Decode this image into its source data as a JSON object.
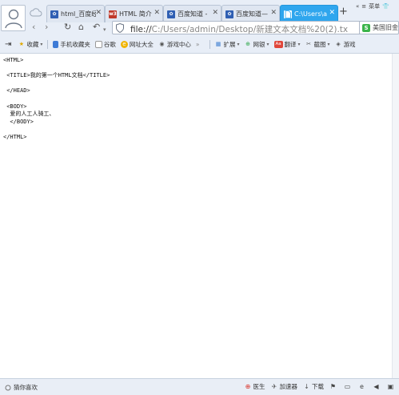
{
  "tabs": [
    {
      "label": "html_百度经",
      "favicon": "baidu-paw-icon",
      "color": "#2f5fb3",
      "active": false
    },
    {
      "label": "HTML 简介",
      "favicon": "w3-icon",
      "color": "#c0392b",
      "active": false
    },
    {
      "label": "百度知道 -",
      "favicon": "baidu-paw-icon",
      "color": "#2f5fb3",
      "active": false
    },
    {
      "label": "百度知道—",
      "favicon": "baidu-paw-icon",
      "color": "#2f5fb3",
      "active": false
    },
    {
      "label": "C:\\Users\\a",
      "favicon": "document-icon",
      "color": "#ffffff",
      "active": true
    }
  ],
  "top_right": {
    "menu_label": "菜单"
  },
  "address": {
    "scheme": "file://",
    "path": "C:/Users/admin/Desktop/新建文本文档%20(2).tx"
  },
  "search": {
    "text": "美国旧金"
  },
  "bookmarks": [
    {
      "label": "收藏",
      "icon": "star-icon",
      "dropdown": true
    },
    {
      "label": "手机收藏夹",
      "icon": "phone-icon",
      "dropdown": false
    },
    {
      "label": "谷歌",
      "icon": "page-icon",
      "dropdown": false
    },
    {
      "label": "网址大全",
      "icon": "globe-icon",
      "dropdown": false
    },
    {
      "label": "游戏中心",
      "icon": "gamepad-icon",
      "dropdown": false
    }
  ],
  "toolbar_right": [
    {
      "label": "扩展",
      "icon": "grid-icon"
    },
    {
      "label": "网银",
      "icon": "bank-icon"
    },
    {
      "label": "翻译",
      "icon": "translate-icon"
    },
    {
      "label": "截图",
      "icon": "scissors-icon"
    },
    {
      "label": "游戏",
      "icon": "game-icon"
    }
  ],
  "document": {
    "text": "<HTML>\n\n <TITLE>我的第一个HTML文档</TITLE>\n\n </HEAD>\n\n <BODY>\n  爱的人工人骑工、\n  </BODY>\n\n</HTML>"
  },
  "status": {
    "left_label": "猜你喜欢",
    "items": [
      {
        "label": "医生",
        "icon": "doctor-icon"
      },
      {
        "label": "加速器",
        "icon": "rocket-icon"
      },
      {
        "label": "下载",
        "icon": "download-icon"
      }
    ]
  }
}
